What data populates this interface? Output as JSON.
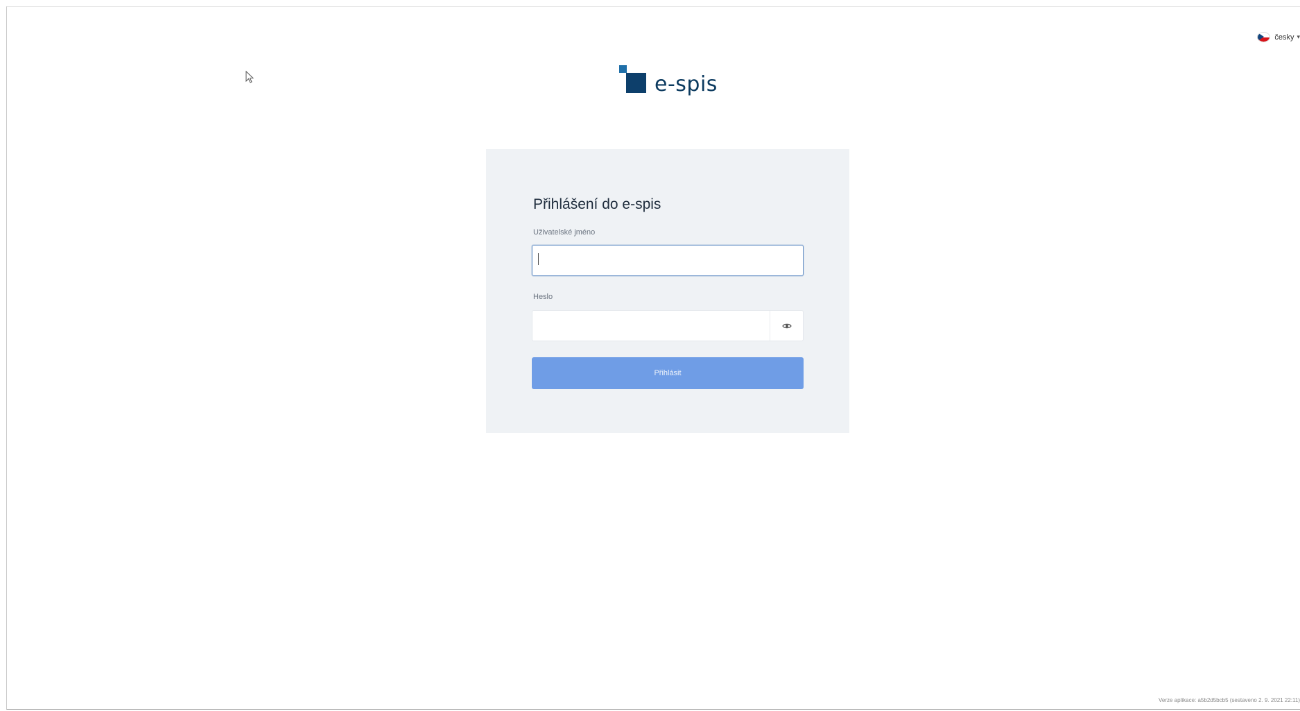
{
  "language": {
    "label": "česky",
    "flag_icon": "czech-flag-icon",
    "chevron_icon": "chevron-down-icon"
  },
  "logo": {
    "text": "e-spis",
    "colors": {
      "small_square": "#1f6fa8",
      "big_square": "#0d3f6b",
      "text": "#0b3a5f"
    }
  },
  "login": {
    "title": "Přihlášení do e-spis",
    "username_label": "Uživatelské jméno",
    "username_value": "",
    "password_label": "Heslo",
    "password_value": "",
    "show_password_icon": "eye-icon",
    "submit_label": "Přihlásit"
  },
  "footer": {
    "version_text": "Verze aplikace: a5b2d5bcb5 (sestaveno 2. 9. 2021 22:11)"
  },
  "colors": {
    "card_background": "#eff2f5",
    "button_background": "#6f9de6",
    "focus_border": "#6b94c8"
  }
}
